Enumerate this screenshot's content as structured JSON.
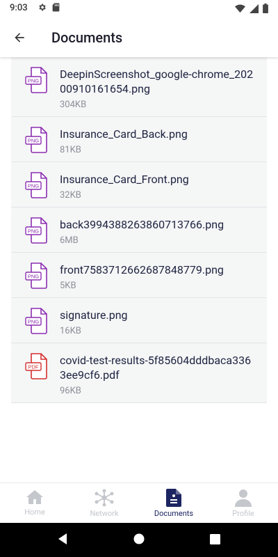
{
  "status_bar": {
    "time": "9:03",
    "icons": [
      "gear-icon",
      "sd-card-icon",
      "wifi-icon",
      "signal-icon",
      "battery-icon"
    ]
  },
  "app_bar": {
    "title": "Documents",
    "back_icon": "arrow-back-icon"
  },
  "documents": [
    {
      "name": "DeepinScreenshot_google-chrome_20200910161654.png",
      "size": "304KB",
      "type": "PNG"
    },
    {
      "name": "Insurance_Card_Back.png",
      "size": "81KB",
      "type": "PNG"
    },
    {
      "name": "Insurance_Card_Front.png",
      "size": "32KB",
      "type": "PNG"
    },
    {
      "name": "back3994388263860713766.png",
      "size": "6MB",
      "type": "PNG"
    },
    {
      "name": "front7583712662687848779.png",
      "size": "5KB",
      "type": "PNG"
    },
    {
      "name": "signature.png",
      "size": "16KB",
      "type": "PNG"
    },
    {
      "name": "covid-test-results-5f85604dddbaca3363ee9cf6.pdf",
      "size": "96KB",
      "type": "PDF"
    }
  ],
  "colors": {
    "png_icon": "#8b2fb0",
    "pdf_icon": "#d32f2f",
    "active_nav": "#1c2561",
    "inactive_nav": "#c4c7cc"
  },
  "bottom_nav": {
    "tabs": [
      {
        "label": "Home",
        "icon": "home-icon",
        "active": false
      },
      {
        "label": "Network",
        "icon": "network-icon",
        "active": false
      },
      {
        "label": "Documents",
        "icon": "document-icon",
        "active": true
      },
      {
        "label": "Profile",
        "icon": "profile-icon",
        "active": false
      }
    ]
  }
}
